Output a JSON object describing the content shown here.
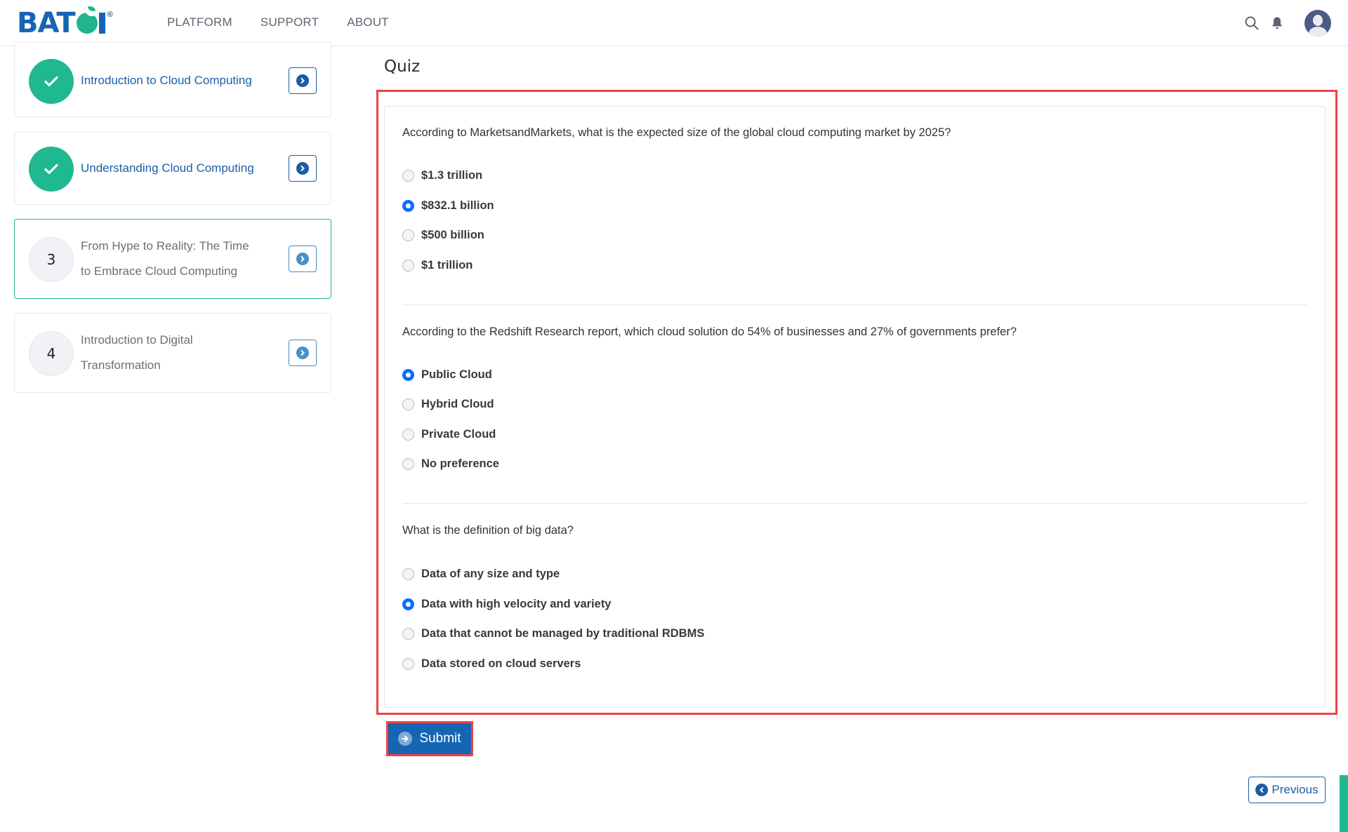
{
  "header": {
    "logo": {
      "text_left": "BAT",
      "text_right": "I",
      "reg_mark": "®",
      "brand_color": "#1565b4",
      "accent_color": "#1fb58f"
    },
    "nav": [
      {
        "label": "PLATFORM"
      },
      {
        "label": "SUPPORT"
      },
      {
        "label": "ABOUT"
      }
    ],
    "icons": {
      "search": "search-icon",
      "notifications": "bell-icon",
      "avatar": "user-avatar"
    }
  },
  "sidebar": {
    "lessons": [
      {
        "status": "completed",
        "marker": "✓",
        "title": "Introduction to Cloud Computing"
      },
      {
        "status": "completed",
        "marker": "✓",
        "title": "Understanding Cloud Computing"
      },
      {
        "status": "active",
        "marker": "3",
        "title_line1": "From Hype to Reality: The Time",
        "title_line2": "to Embrace Cloud Computing"
      },
      {
        "status": "pending",
        "marker": "4",
        "title_line1": "Introduction to Digital",
        "title_line2": "Transformation"
      }
    ]
  },
  "main": {
    "title": "Quiz",
    "questions": [
      {
        "text": "According to MarketsandMarkets, what is the expected size of the global cloud computing market by 2025?",
        "options": [
          "$1.3 trillion",
          "$832.1 billion",
          "$500 billion",
          "$1 trillion"
        ],
        "selected_index": 1
      },
      {
        "text": "According to the Redshift Research report, which cloud solution do 54% of businesses and 27% of governments prefer?",
        "options": [
          "Public Cloud",
          "Hybrid Cloud",
          "Private Cloud",
          "No preference"
        ],
        "selected_index": 0
      },
      {
        "text": "What is the definition of big data?",
        "options": [
          "Data of any size and type",
          "Data with high velocity and variety",
          "Data that cannot be managed by traditional RDBMS",
          "Data stored on cloud servers"
        ],
        "selected_index": 1
      }
    ],
    "submit_label": "Submit",
    "previous_label": "Previous",
    "highlight_color": "#ef4146",
    "radio_checked_color": "#0d6efd"
  }
}
